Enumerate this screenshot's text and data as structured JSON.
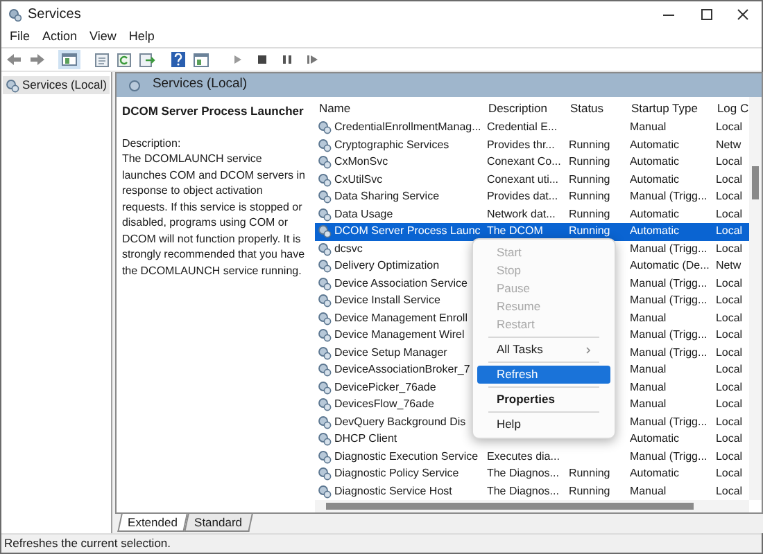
{
  "window": {
    "title": "Services"
  },
  "menu": [
    "File",
    "Action",
    "View",
    "Help"
  ],
  "tree": [
    {
      "label": "Services (Local)",
      "selected": true
    }
  ],
  "pane_header": "Services (Local)",
  "details": {
    "title": "DCOM Server Process Launcher",
    "description_label": "Description:",
    "description": "The DCOMLAUNCH service launches COM and DCOM servers in response to object activation requests. If this service is stopped or disabled, programs using COM or DCOM will not function properly. It is strongly recommended that you have the DCOMLAUNCH service running."
  },
  "table": {
    "columns": [
      "Name",
      "Description",
      "Status",
      "Startup Type",
      "Log C"
    ],
    "rows": [
      {
        "name": "CredentialEnrollmentManag...",
        "description": "Credential E...",
        "startup_type": "Manual",
        "log_on": "Local",
        "selected": false
      },
      {
        "name": "Cryptographic Services",
        "description": "Provides thr...",
        "status": "Running",
        "startup_type": "Automatic",
        "log_on": "Netw",
        "selected": false
      },
      {
        "name": "CxMonSvc",
        "description": "Conexant Co...",
        "status": "Running",
        "startup_type": "Automatic",
        "log_on": "Local",
        "selected": false
      },
      {
        "name": "CxUtilSvc",
        "description": "Conexant uti...",
        "status": "Running",
        "startup_type": "Automatic",
        "log_on": "Local",
        "selected": false
      },
      {
        "name": "Data Sharing Service",
        "description": "Provides dat...",
        "status": "Running",
        "startup_type": "Manual (Trigg...",
        "log_on": "Local",
        "selected": false
      },
      {
        "name": "Data Usage",
        "description": "Network dat...",
        "status": "Running",
        "startup_type": "Automatic",
        "log_on": "Local",
        "selected": false
      },
      {
        "name": "DCOM Server Process Launc",
        "description": "The DCOM",
        "status": "Running",
        "startup_type": "Automatic",
        "log_on": "Local",
        "selected": true
      },
      {
        "name": "dcsvc",
        "startup_type": "Manual (Trigg...",
        "log_on": "Local",
        "selected": false
      },
      {
        "name": "Delivery Optimization",
        "startup_type": "Automatic (De...",
        "log_on": "Netw",
        "selected": false
      },
      {
        "name": "Device Association Service",
        "startup_type": "Manual (Trigg...",
        "log_on": "Local",
        "selected": false
      },
      {
        "name": "Device Install Service",
        "startup_type": "Manual (Trigg...",
        "log_on": "Local",
        "selected": false
      },
      {
        "name": "Device Management Enroll",
        "startup_type": "Manual",
        "log_on": "Local",
        "selected": false
      },
      {
        "name": "Device Management Wirel",
        "startup_type": "Manual (Trigg...",
        "log_on": "Local",
        "selected": false
      },
      {
        "name": "Device Setup Manager",
        "startup_type": "Manual (Trigg...",
        "log_on": "Local",
        "selected": false
      },
      {
        "name": "DeviceAssociationBroker_7",
        "startup_type": "Manual",
        "log_on": "Local",
        "selected": false
      },
      {
        "name": "DevicePicker_76ade",
        "startup_type": "Manual",
        "log_on": "Local",
        "selected": false
      },
      {
        "name": "DevicesFlow_76ade",
        "startup_type": "Manual",
        "log_on": "Local",
        "selected": false
      },
      {
        "name": "DevQuery Background Dis",
        "startup_type": "Manual (Trigg...",
        "log_on": "Local",
        "selected": false
      },
      {
        "name": "DHCP Client",
        "startup_type": "Automatic",
        "log_on": "Local",
        "selected": false
      },
      {
        "name": "Diagnostic Execution Service",
        "description": "Executes dia...",
        "startup_type": "Manual (Trigg...",
        "log_on": "Local",
        "selected": false
      },
      {
        "name": "Diagnostic Policy Service",
        "description": "The Diagnos...",
        "status": "Running",
        "startup_type": "Automatic",
        "log_on": "Local",
        "selected": false
      },
      {
        "name": "Diagnostic Service Host",
        "description": "The Diagnos...",
        "status": "Running",
        "startup_type": "Manual",
        "log_on": "Local",
        "selected": false
      }
    ]
  },
  "context_menu": [
    {
      "label": "Start",
      "disabled": true,
      "selected": false,
      "default": false,
      "submenu": false,
      "separator_before": false
    },
    {
      "label": "Stop",
      "disabled": true,
      "selected": false,
      "default": false,
      "submenu": false,
      "separator_before": false
    },
    {
      "label": "Pause",
      "disabled": true,
      "selected": false,
      "default": false,
      "submenu": false,
      "separator_before": false
    },
    {
      "label": "Resume",
      "disabled": true,
      "selected": false,
      "default": false,
      "submenu": false,
      "separator_before": false
    },
    {
      "label": "Restart",
      "disabled": true,
      "selected": false,
      "default": false,
      "submenu": false,
      "separator_before": false
    },
    {
      "label": "All Tasks",
      "disabled": false,
      "selected": false,
      "default": false,
      "submenu": true,
      "separator_before": true
    },
    {
      "label": "Refresh",
      "disabled": false,
      "selected": true,
      "default": false,
      "submenu": false,
      "separator_before": true
    },
    {
      "label": "Properties",
      "disabled": false,
      "selected": false,
      "default": true,
      "submenu": false,
      "separator_before": true
    },
    {
      "label": "Help",
      "disabled": false,
      "selected": false,
      "default": false,
      "submenu": false,
      "separator_before": true
    }
  ],
  "view_tabs": [
    {
      "label": "Extended",
      "selected": true
    },
    {
      "label": "Standard",
      "selected": false
    }
  ],
  "status_bar": "Refreshes the current selection."
}
